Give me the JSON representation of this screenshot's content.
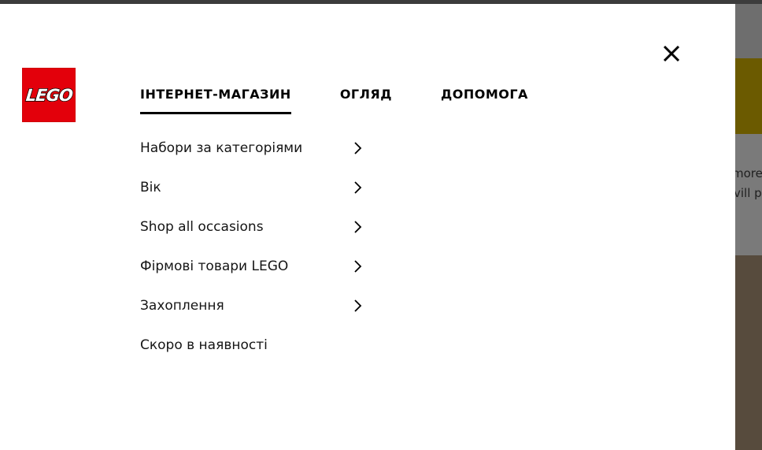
{
  "logo": {
    "text": "LEGO",
    "color": "#e3000b"
  },
  "close_icon": "close-icon",
  "tabs": [
    {
      "label": "ІНТЕРНЕТ-МАГАЗИН",
      "active": true
    },
    {
      "label": "ОГЛЯД",
      "active": false
    },
    {
      "label": "ДОПОМОГА",
      "active": false
    }
  ],
  "menu": [
    {
      "label": "Набори за категоріями",
      "has_submenu": true
    },
    {
      "label": "Вік",
      "has_submenu": true
    },
    {
      "label": "Shop all occasions",
      "has_submenu": true
    },
    {
      "label": "Фірмові товари LEGO",
      "has_submenu": true
    },
    {
      "label": "Захоплення",
      "has_submenu": true
    },
    {
      "label": "Скоро в наявності",
      "has_submenu": false
    }
  ],
  "background_page": {
    "line1": "more",
    "line2": "vill pr"
  }
}
